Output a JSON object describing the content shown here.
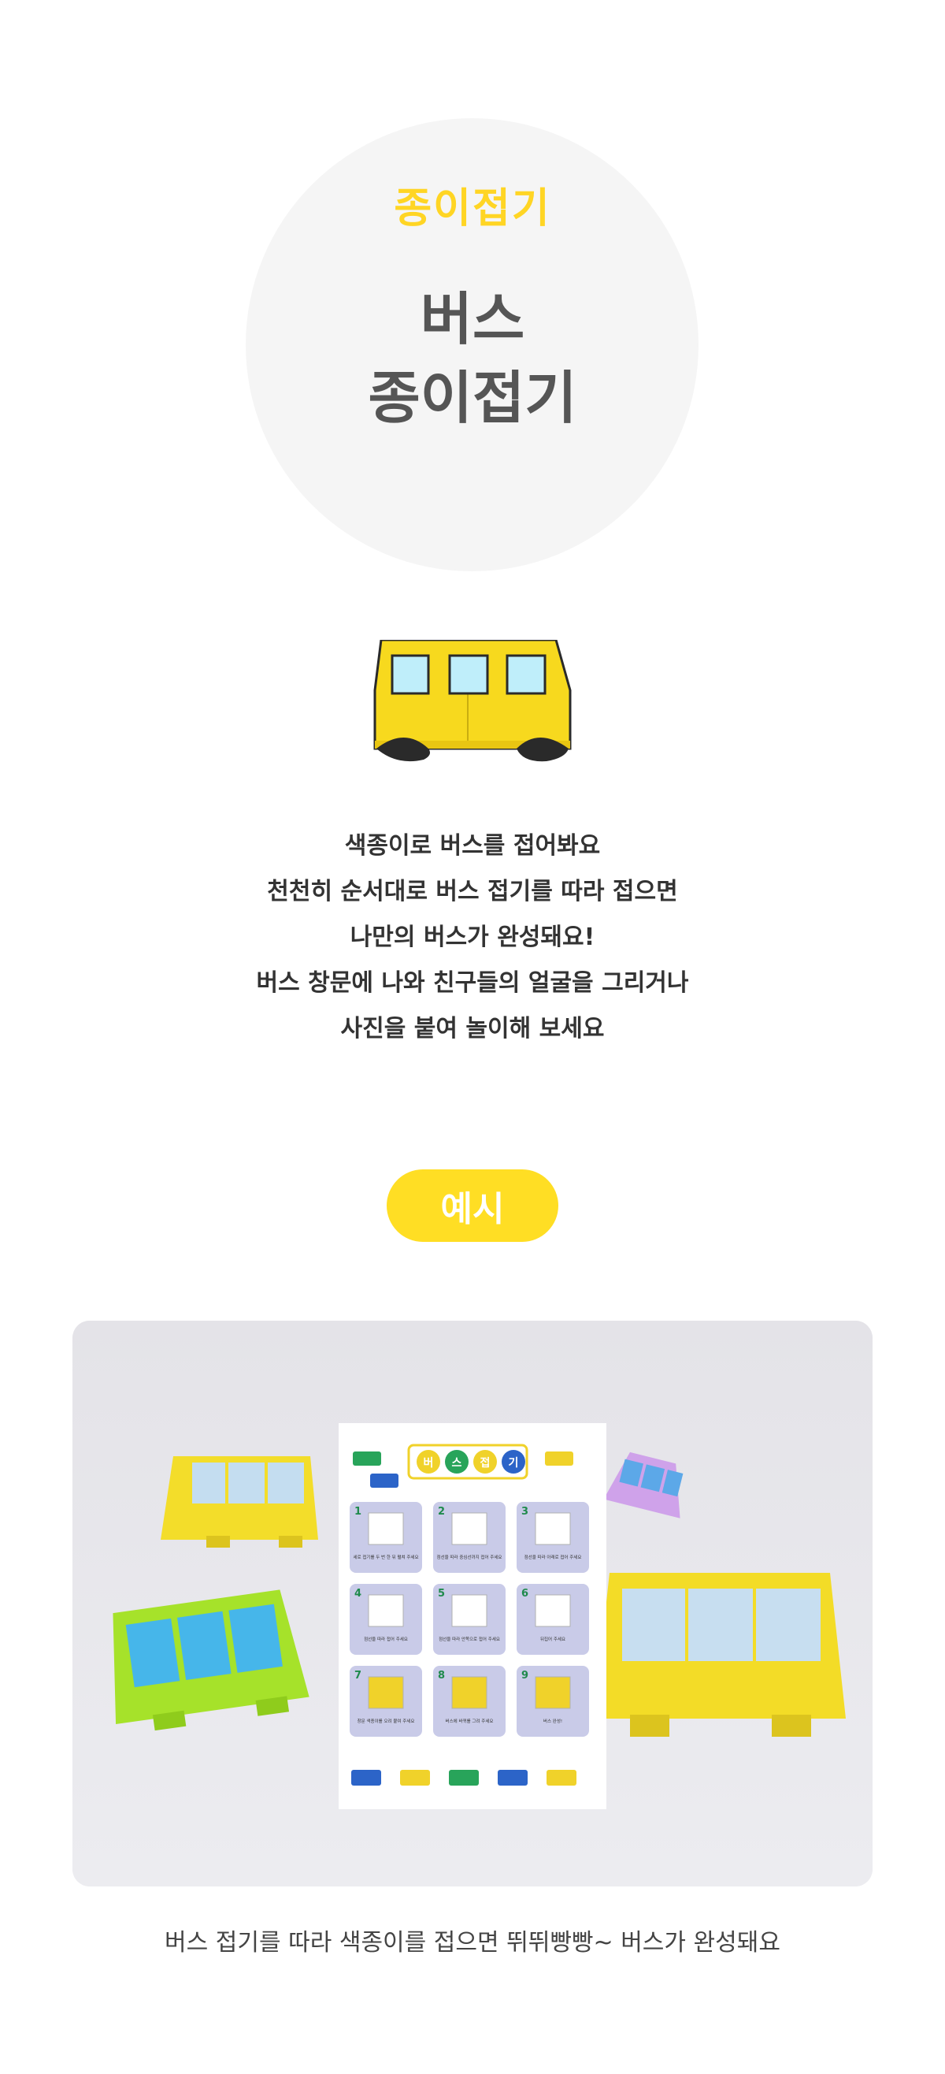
{
  "hero": {
    "subtitle": "종이접기",
    "title_line1": "버스",
    "title_line2": "종이접기"
  },
  "description": {
    "lines": [
      "색종이로 버스를 접어봐요",
      "천천히 순서대로 버스 접기를 따라 접으면",
      "나만의 버스가 완성돼요!",
      "버스 창문에 나와 친구들의 얼굴을 그리거나",
      "사진을 붙여 놀이해 보세요"
    ]
  },
  "example": {
    "badge": "예시"
  },
  "instruction_sheet": {
    "title_chars": [
      "버",
      "스",
      "접",
      "기"
    ],
    "steps": [
      {
        "num": "1",
        "text": "세로 접기를 두 번 한 뒤 펼쳐 주세요"
      },
      {
        "num": "2",
        "text": "점선을 따라 중심선까지 접어 주세요"
      },
      {
        "num": "3",
        "text": "점선을 따라 아래로 접어 주세요"
      },
      {
        "num": "4",
        "text": "점선을 따라 접어 주세요"
      },
      {
        "num": "5",
        "text": "점선을 따라 안쪽으로 접어 주세요"
      },
      {
        "num": "6",
        "text": "뒤집어 주세요"
      },
      {
        "num": "7",
        "text": "창문 색종이를 오려 붙여 주세요"
      },
      {
        "num": "8",
        "text": "버스에 바퀴를 그려 주세요"
      },
      {
        "num": "9",
        "text": "버스 완성!"
      }
    ]
  },
  "caption": "버스 접기를 따라 색종이를 접으면 뛰뛰빵빵~ 버스가 완성돼요",
  "colors": {
    "accent_yellow": "#ffde24",
    "bus_yellow": "#f7d91e",
    "window_blue": "#bfeefa",
    "circle_bg": "#f5f5f5"
  }
}
